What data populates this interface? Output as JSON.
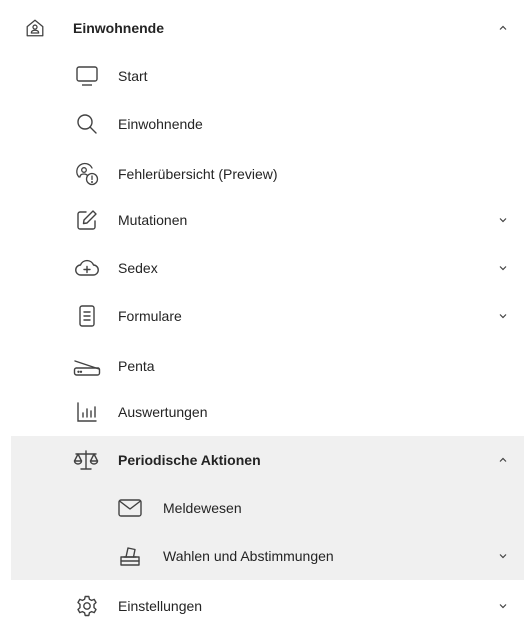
{
  "nav": {
    "root": {
      "label": "Einwohnende",
      "icon": "home-person-icon",
      "expanded": true
    },
    "items": [
      {
        "label": "Start",
        "icon": "monitor-icon"
      },
      {
        "label": "Einwohnende",
        "icon": "search-icon"
      },
      {
        "label": "Fehlerübersicht (Preview)",
        "icon": "people-alert-icon"
      },
      {
        "label": "Mutationen",
        "icon": "edit-icon",
        "has_children": true
      },
      {
        "label": "Sedex",
        "icon": "cloud-add-icon",
        "has_children": true
      },
      {
        "label": "Formulare",
        "icon": "document-icon",
        "has_children": true
      },
      {
        "label": "Penta",
        "icon": "scanner-icon"
      },
      {
        "label": "Auswertungen",
        "icon": "bar-chart-icon"
      },
      {
        "label": "Periodische Aktionen",
        "icon": "scales-icon",
        "expanded": true
      },
      {
        "label": "Meldewesen",
        "icon": "mail-icon"
      },
      {
        "label": "Wahlen und Abstimmungen",
        "icon": "ballot-box-icon",
        "has_children": true
      },
      {
        "label": "Einstellungen",
        "icon": "gear-icon",
        "has_children": true
      }
    ]
  },
  "colors": {
    "text": "#242424",
    "icon": "#424242",
    "selected_bg": "#f0f0f0"
  }
}
